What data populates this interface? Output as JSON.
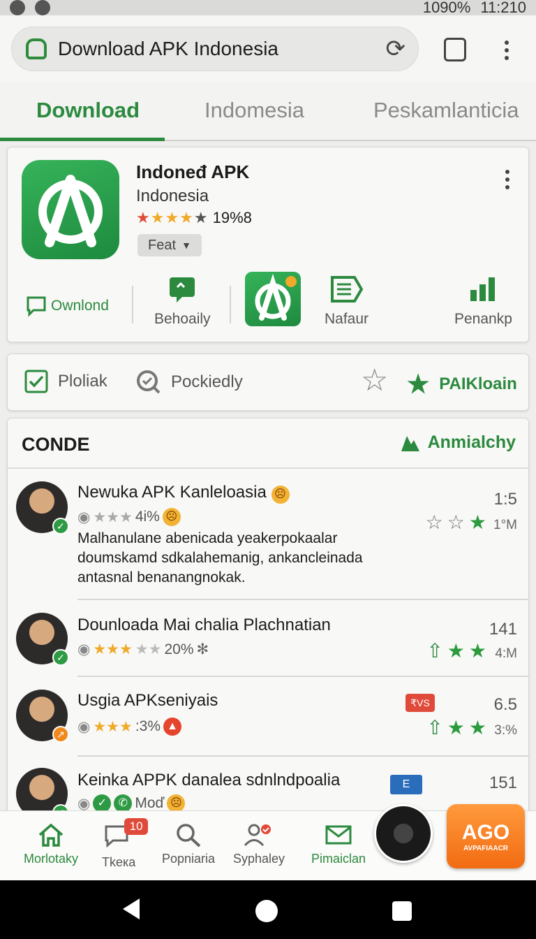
{
  "status_bar": {
    "battery": "1090%",
    "time": "11:210"
  },
  "address_bar": {
    "title": "Download APK Indonesia",
    "tab_count": ""
  },
  "tabs": [
    {
      "label": "Download",
      "active": true
    },
    {
      "label": "Indomesia",
      "active": false
    },
    {
      "label": "Peskamlanticia",
      "active": false
    }
  ],
  "app_card": {
    "name": "Indoneđ APK",
    "publisher": "Indonesia",
    "rating_value": 4,
    "rating_text": "19%8",
    "feat_label": "Feat",
    "actions": [
      {
        "label": "Ownlond",
        "icon": "chat-icon"
      },
      {
        "label": "Behoaily",
        "icon": "message-icon"
      },
      {
        "label": "",
        "icon": "app-logo-icon"
      },
      {
        "label": "Nafaur",
        "icon": "document-icon"
      },
      {
        "label": "Penankp",
        "icon": "bar-chart-icon"
      }
    ]
  },
  "filters": {
    "item1": "Ploliak",
    "item2": "Pockiedly",
    "item3": "PAIKloain"
  },
  "list": {
    "title": "CONDE",
    "analytics_label": "Anmialchy",
    "rows": [
      {
        "title": "Newuka APK Kanleloasia",
        "meta": "4i%",
        "desc": "Malhanulane abenicada yeakerpokaalar doumskamd sdkalahemanig, ankancleinada antasnal benanangnokak.",
        "num": "1:5",
        "num2": "1°M"
      },
      {
        "title": "Dounloada  Mai chalia Plachnatian",
        "meta": "20%",
        "desc": "",
        "num": "141",
        "num2": "4:M"
      },
      {
        "title": "Usgia APKseniyais",
        "meta": ":3%",
        "desc": "",
        "num": "6.5",
        "num2": "3:%",
        "tag": "₹VS"
      },
      {
        "title": "Keinka APPK danalea sdnlndpoalia",
        "meta": "Moď",
        "desc": "",
        "num": "151",
        "num2": "",
        "tag": "E"
      }
    ]
  },
  "bottom_nav": {
    "items": [
      {
        "label": "Morlotaky",
        "icon": "home-icon",
        "active": true
      },
      {
        "label": "Tkeка",
        "icon": "chat-bubble-icon",
        "active": false,
        "badge": "10"
      },
      {
        "label": "Popniaria",
        "icon": "search-icon",
        "active": false
      },
      {
        "label": "Syphaley",
        "icon": "people-icon",
        "active": false
      },
      {
        "label": "Pimaiclan",
        "icon": "mail-icon",
        "active": true
      }
    ],
    "promo_big": "AGO",
    "promo_small": "AVPAFIAACR"
  },
  "colors": {
    "accent": "#2b8a3e",
    "star": "#f0a928",
    "orange": "#f26b12"
  }
}
